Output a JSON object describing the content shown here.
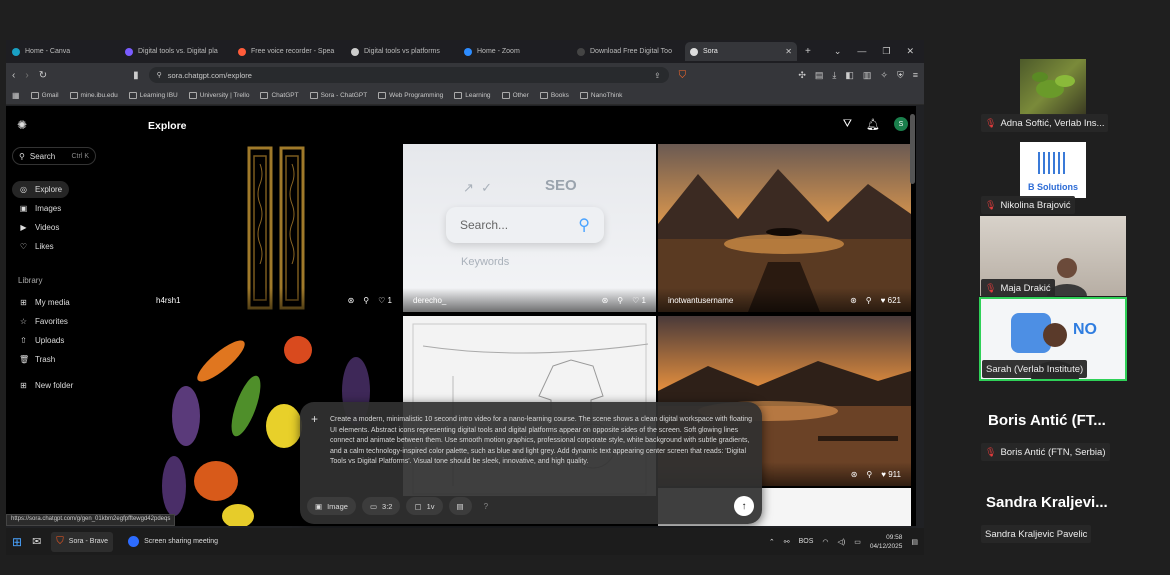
{
  "browser": {
    "tabs": [
      {
        "label": "Home - Canva",
        "color": "#19a0c4"
      },
      {
        "label": "Digital tools vs. Digital pla",
        "color": "#7a5cff"
      },
      {
        "label": "Free voice recorder - Spea",
        "color": "#ff5c3a"
      },
      {
        "label": "Digital tools vs platforms",
        "color": "#cccccc"
      },
      {
        "label": "Home - Zoom",
        "color": "#2d8cff"
      },
      {
        "label": "Download Free Digital Too",
        "color": "#444444"
      },
      {
        "label": "Sora",
        "color": "#dddddd",
        "active": true
      }
    ],
    "url": "sora.chatgpt.com/explore",
    "bookmarks": [
      "Gmail",
      "mine.ibu.edu",
      "Learning IBU",
      "University | Trello",
      "ChatGPT",
      "Sora - ChatGPT",
      "Web Programming",
      "Learning",
      "Other",
      "Books",
      "NanoThink"
    ],
    "status_url": "https://sora.chatgpt.com/g/gen_01kbm2egfpfftewgd42pdeqs"
  },
  "sidebar": {
    "search_label": "Search",
    "search_shortcut": "Ctrl K",
    "nav": [
      {
        "label": "Explore",
        "icon": "compass-icon",
        "glyph": "◎"
      },
      {
        "label": "Images",
        "icon": "image-icon",
        "glyph": "▣"
      },
      {
        "label": "Videos",
        "icon": "video-icon",
        "glyph": "▶"
      },
      {
        "label": "Likes",
        "icon": "heart-icon",
        "glyph": "♡"
      }
    ],
    "library_title": "Library",
    "library": [
      {
        "label": "My media",
        "icon": "media-icon",
        "glyph": "⊞"
      },
      {
        "label": "Favorites",
        "icon": "star-icon",
        "glyph": "☆"
      },
      {
        "label": "Uploads",
        "icon": "upload-icon",
        "glyph": "⇧"
      },
      {
        "label": "Trash",
        "icon": "trash-icon",
        "glyph": "🗑"
      }
    ],
    "new_folder": "New folder"
  },
  "main": {
    "title": "Explore",
    "tiles": [
      {
        "user": "h4rsh1",
        "likes": "1"
      },
      {
        "user": "derecho_",
        "likes": "1"
      },
      {
        "user": "inotwantusername",
        "likes": "621"
      },
      {
        "user": "",
        "likes": "911"
      }
    ],
    "search_mock_text": "Search...",
    "seo_text": "SEO",
    "keywords_text": "Keywords"
  },
  "prompt": {
    "text": "Create a modern, minimalistic 10 second intro video for a nano-learning course. The scene shows a clean digital workspace with floating UI elements. Abstract icons representing digital tools and digital platforms appear on opposite sides of the screen. Soft glowing lines connect and animate between them. Use smooth motion graphics, professional corporate style, white background with subtle gradients, and a calm technology-inspired color palette, such as blue and light grey. Add dynamic text appearing center screen that reads: 'Digital Tools vs Digital Platforms'. Visual tone should be sleek, innovative, and high quality.",
    "mode": "Image",
    "ratio": "3:2",
    "count": "1v",
    "help": "?"
  },
  "taskbar": {
    "apps": [
      "Sora - Brave",
      "Screen sharing meeting"
    ],
    "lang": "BOS",
    "time": "09:58",
    "date": "04/12/2025"
  },
  "participants": [
    {
      "name": "Adna Softić, Verlab Ins..."
    },
    {
      "name": "Nikolina Brajović",
      "tile_text": "B Solutions"
    },
    {
      "name": "Maja Drakić"
    },
    {
      "name": "Sarah (Verlab Institute)",
      "tile_text": "NO"
    },
    {
      "name": "Boris Antić (FTN, Serbia)",
      "big": "Boris Antić (FT..."
    },
    {
      "name": "Sandra Kraljevic Pavelic",
      "big": "Sandra  Kraljevi..."
    }
  ]
}
